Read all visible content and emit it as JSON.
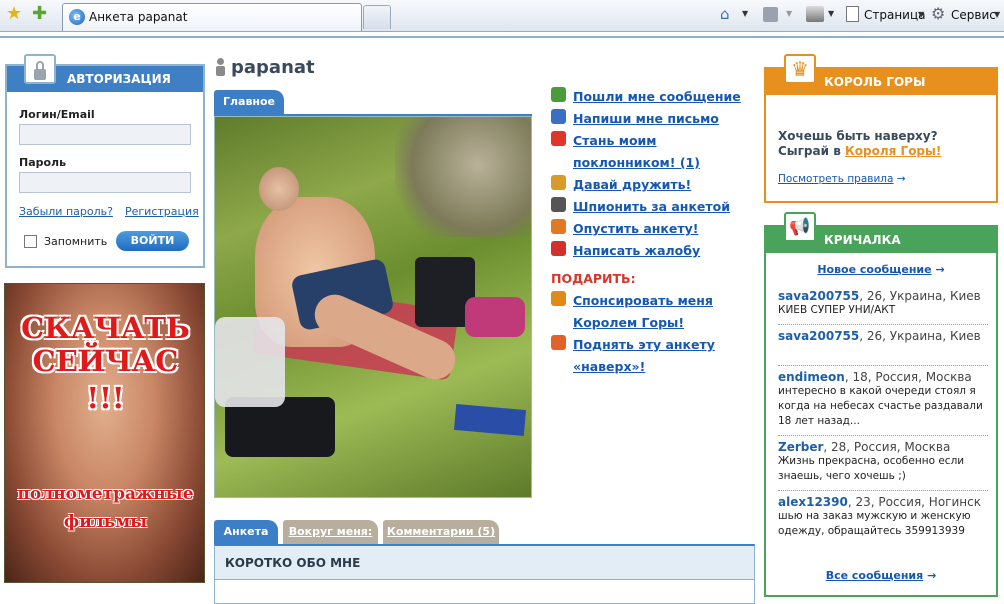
{
  "browser": {
    "tab_title": "Анкета papanat",
    "page_menu": "Страница",
    "tools_menu": "Сервис"
  },
  "auth": {
    "title": "АВТОРИЗАЦИЯ",
    "login_label": "Логин/Email",
    "login_value": "",
    "password_label": "Пароль",
    "password_value": "",
    "forgot": "Забыли пароль?",
    "register": "Регистрация",
    "remember": "Запомнить",
    "submit": "ВОЙТИ"
  },
  "ad": {
    "line1": "СКАЧАТЬ",
    "line2": "СЕЙЧАС",
    "line3": "!!!",
    "line4": "полнометражные",
    "line5": "фильмы"
  },
  "profile": {
    "username": "papanat",
    "photo_tab": "Главное",
    "actions": [
      {
        "icon": "message-icon",
        "label": "Пошли мне сообщение",
        "color": "#4a9b3a"
      },
      {
        "icon": "letter-icon",
        "label": "Напиши мне письмо",
        "color": "#3a6fc4"
      },
      {
        "icon": "heart-icon",
        "label": "Стань моим поклонником! (1)",
        "color": "#e0352b"
      },
      {
        "icon": "friends-icon",
        "label": "Давай дружить!",
        "color": "#d89a2a"
      },
      {
        "icon": "spy-icon",
        "label": "Шпионить за анкетой",
        "color": "#555555"
      },
      {
        "icon": "thumb-down-icon",
        "label": "Опустить анкету!",
        "color": "#e07a22"
      },
      {
        "icon": "complaint-icon",
        "label": "Написать жалобу",
        "color": "#d2302a"
      }
    ],
    "gift_title": "ПОДАРИТЬ:",
    "gifts": [
      {
        "icon": "crown-icon",
        "label": "Спонсировать меня Королем Горы!",
        "color": "#e08a1a"
      },
      {
        "icon": "up-arrow-icon",
        "label": "Поднять эту анкету «наверх»!",
        "color": "#e2632a"
      }
    ],
    "tabs": [
      "Анкета",
      "Вокруг меня:",
      "Комментарии (5)"
    ],
    "section_title": "КОРОТКО ОБО МНЕ"
  },
  "king": {
    "title": "КОРОЛЬ ГОРЫ",
    "question": "Хочешь быть наверху?",
    "play_prefix": "Сыграй в ",
    "play_link": "Короля Горы!",
    "rules": "Посмотреть правила"
  },
  "shout": {
    "title": "КРИЧАЛКА",
    "new_message": "Новое сообщение",
    "all_messages": "Все сообщения",
    "items": [
      {
        "name": "sava200755",
        "meta": ", 26, Украина, Киев",
        "text": "КИЕВ СУПЕР УНИ/АКТ"
      },
      {
        "name": "sava200755",
        "meta": ", 26, Украина, Киев",
        "text": ""
      },
      {
        "name": "endimeon",
        "meta": ", 18, Россия, Москва",
        "text": "интересно в какой очереди стоял я когда на небесах счастье раздавали 18 лет назад..."
      },
      {
        "name": "Zerber",
        "meta": ", 28, Россия, Москва",
        "text": "Жизнь прекрасна, особенно если знаешь, чего хочешь ;)"
      },
      {
        "name": "alex12390",
        "meta": ", 23, Россия, Ногинск",
        "text": "шью на заказ мужскую и женскую одежду, обращайтесь 359913939"
      }
    ]
  },
  "colors": {
    "auth_header": "#3f7fc4",
    "king_header": "#e8901e",
    "shout_header": "#4aa35a",
    "link": "#1558b0",
    "gift_title": "#d8352b"
  }
}
